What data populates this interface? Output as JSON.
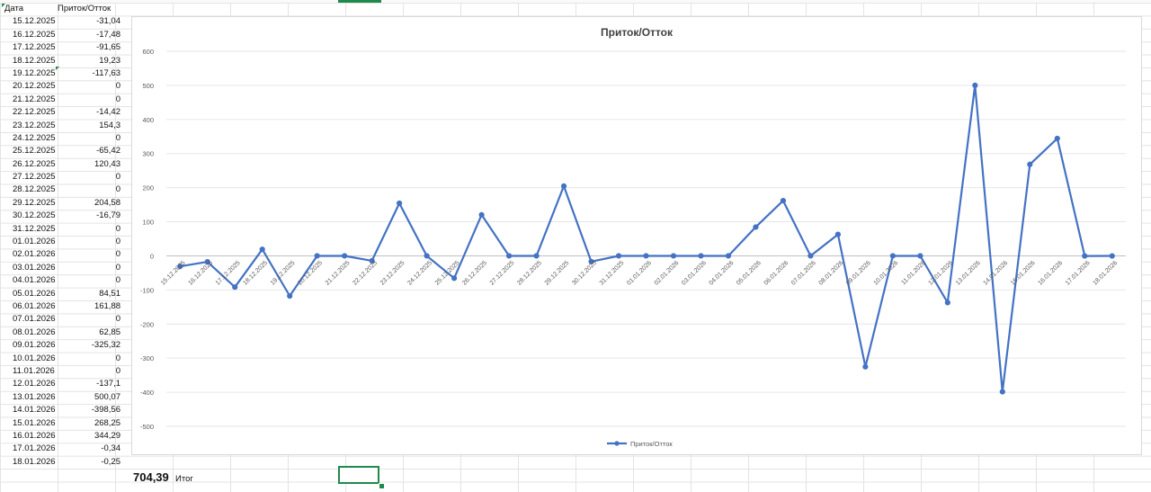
{
  "sheet": {
    "header": {
      "date": "Дата",
      "flow": "Приток/Отток"
    },
    "rows": [
      {
        "date": "15.12.2025",
        "value": "-31,04"
      },
      {
        "date": "16.12.2025",
        "value": "-17,48"
      },
      {
        "date": "17.12.2025",
        "value": "-91,65"
      },
      {
        "date": "18.12.2025",
        "value": "19,23"
      },
      {
        "date": "19.12.2025",
        "value": "-117,63"
      },
      {
        "date": "20.12.2025",
        "value": "0"
      },
      {
        "date": "21.12.2025",
        "value": "0"
      },
      {
        "date": "22.12.2025",
        "value": "-14,42"
      },
      {
        "date": "23.12.2025",
        "value": "154,3"
      },
      {
        "date": "24.12.2025",
        "value": "0"
      },
      {
        "date": "25.12.2025",
        "value": "-65,42"
      },
      {
        "date": "26.12.2025",
        "value": "120,43"
      },
      {
        "date": "27.12.2025",
        "value": "0"
      },
      {
        "date": "28.12.2025",
        "value": "0"
      },
      {
        "date": "29.12.2025",
        "value": "204,58"
      },
      {
        "date": "30.12.2025",
        "value": "-16,79"
      },
      {
        "date": "31.12.2025",
        "value": "0"
      },
      {
        "date": "01.01.2026",
        "value": "0"
      },
      {
        "date": "02.01.2026",
        "value": "0"
      },
      {
        "date": "03.01.2026",
        "value": "0"
      },
      {
        "date": "04.01.2026",
        "value": "0"
      },
      {
        "date": "05.01.2026",
        "value": "84,51"
      },
      {
        "date": "06.01.2026",
        "value": "161,88"
      },
      {
        "date": "07.01.2026",
        "value": "0"
      },
      {
        "date": "08.01.2026",
        "value": "62,85"
      },
      {
        "date": "09.01.2026",
        "value": "-325,32"
      },
      {
        "date": "10.01.2026",
        "value": "0"
      },
      {
        "date": "11.01.2026",
        "value": "0"
      },
      {
        "date": "12.01.2026",
        "value": "-137,1"
      },
      {
        "date": "13.01.2026",
        "value": "500,07"
      },
      {
        "date": "14.01.2026",
        "value": "-398,56"
      },
      {
        "date": "15.01.2026",
        "value": "268,25"
      },
      {
        "date": "16.01.2026",
        "value": "344,29"
      },
      {
        "date": "17.01.2026",
        "value": "-0,34"
      },
      {
        "date": "18.01.2026",
        "value": "-0,25"
      }
    ],
    "total": {
      "value": "704,39",
      "label": "Итог"
    }
  },
  "colors": {
    "series": "#4472c4",
    "accent": "#1f8a4c"
  },
  "chart_data": {
    "type": "line",
    "title": "Приток/Отток",
    "xlabel": "",
    "ylabel": "",
    "ylim": [
      -500,
      600
    ],
    "yticks": [
      600,
      500,
      400,
      300,
      200,
      100,
      0,
      -100,
      -200,
      -300,
      -400,
      -500
    ],
    "grid": true,
    "legend": "bottom",
    "categories": [
      "15.12.2025",
      "16.12.2025",
      "17.12.2025",
      "18.12.2025",
      "19.12.2025",
      "20.12.2025",
      "21.12.2025",
      "22.12.2025",
      "23.12.2025",
      "24.12.2025",
      "25.12.2025",
      "26.12.2025",
      "27.12.2025",
      "28.12.2025",
      "29.12.2025",
      "30.12.2025",
      "31.12.2025",
      "01.01.2026",
      "02.01.2026",
      "03.01.2026",
      "04.01.2026",
      "05.01.2026",
      "06.01.2026",
      "07.01.2026",
      "08.01.2026",
      "09.01.2026",
      "10.01.2026",
      "11.01.2026",
      "12.01.2026",
      "13.01.2026",
      "14.01.2026",
      "15.01.2026",
      "16.01.2026",
      "17.01.2026",
      "18.01.2026"
    ],
    "series": [
      {
        "name": "Приток/Отток",
        "values": [
          -31.04,
          -17.48,
          -91.65,
          19.23,
          -117.63,
          0,
          0,
          -14.42,
          154.3,
          0,
          -65.42,
          120.43,
          0,
          0,
          204.58,
          -16.79,
          0,
          0,
          0,
          0,
          0,
          84.51,
          161.88,
          0,
          62.85,
          -325.32,
          0,
          0,
          -137.1,
          500.07,
          -398.56,
          268.25,
          344.29,
          -0.34,
          -0.25
        ]
      }
    ]
  }
}
